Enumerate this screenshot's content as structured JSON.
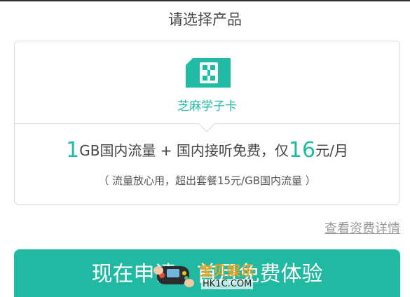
{
  "page": {
    "title": "请选择产品"
  },
  "product": {
    "name": "芝麻学子卡",
    "icon": "sim-card-icon",
    "offer": {
      "data_amount": "1",
      "data_text": "GB国内流量 + 国内接听免费，仅",
      "price": "16",
      "price_unit": "元/月"
    },
    "note": "（ 流量放心用，超出套餐15元/GB国内流量 ）"
  },
  "links": {
    "details": "查看资费详情"
  },
  "cta": {
    "label": "现在申请，首月免费体验"
  },
  "watermark": {
    "text": "宝贝娱乐",
    "domain": "HK1C.COM"
  },
  "colors": {
    "accent": "#22b9a3",
    "text": "#444444",
    "link": "#999999",
    "watermark": "#f3a11b"
  }
}
